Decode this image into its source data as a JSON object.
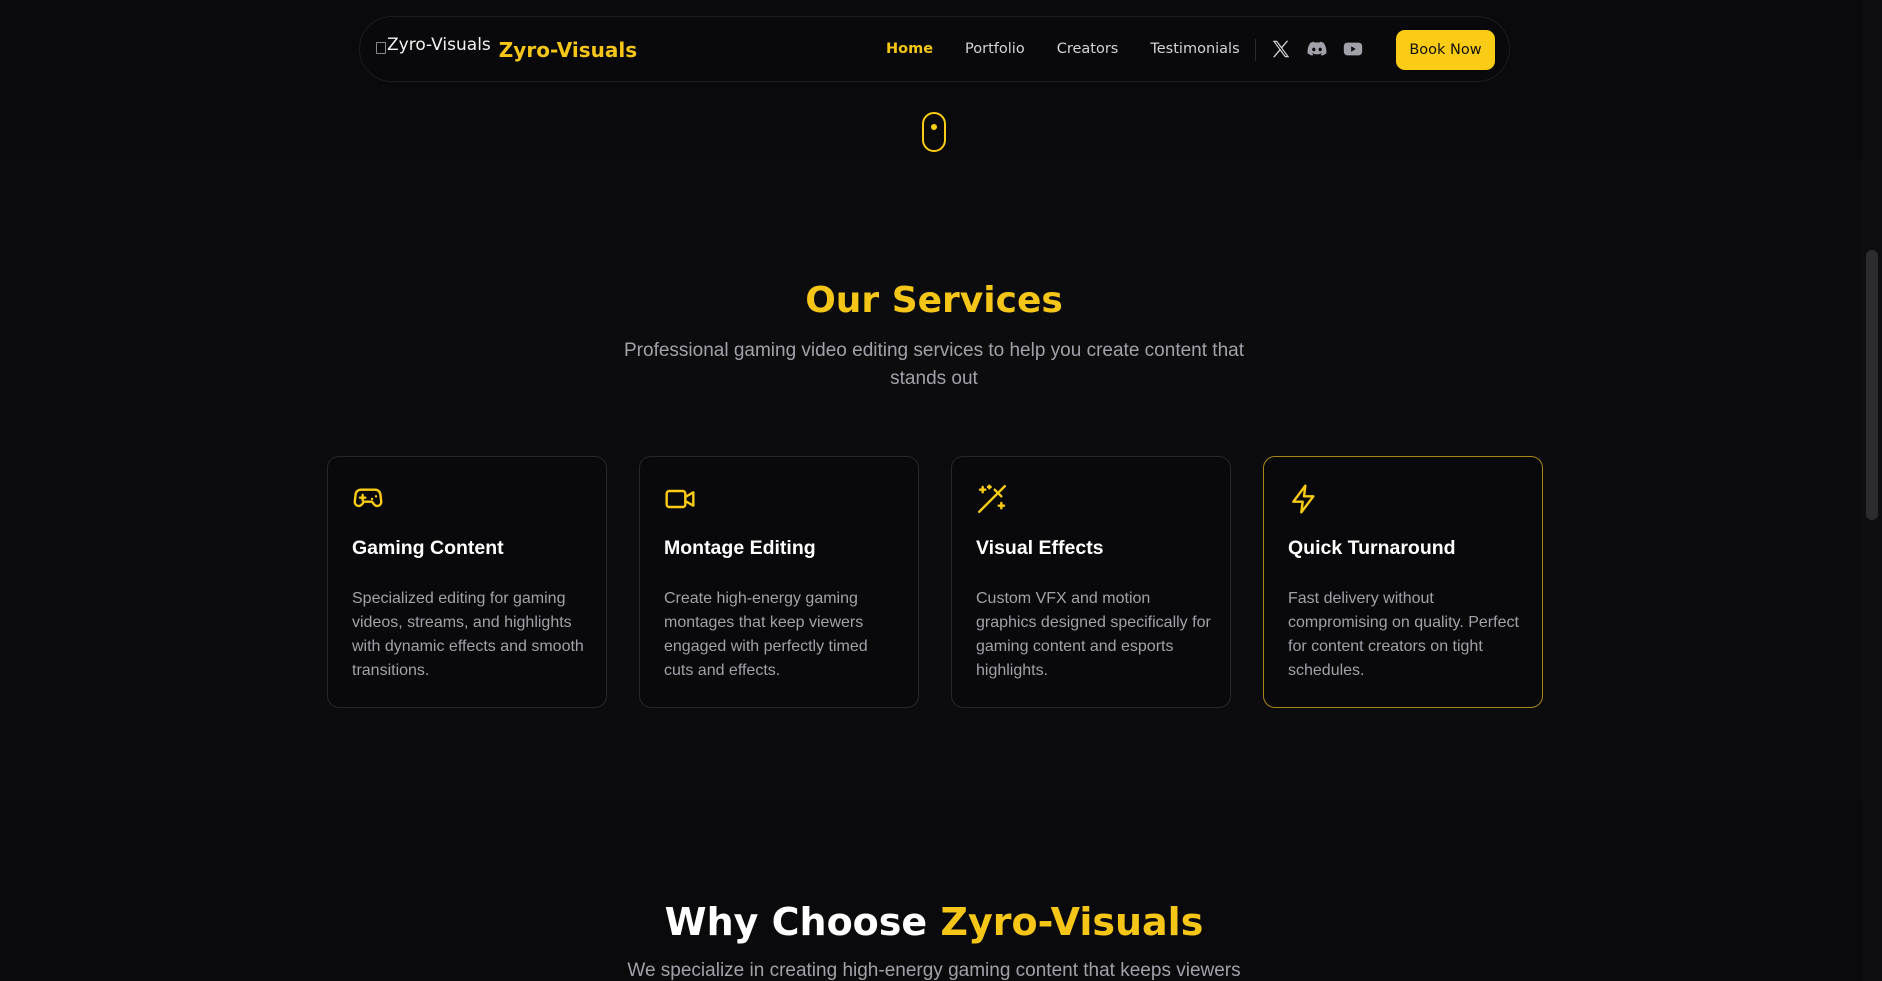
{
  "nav": {
    "logo_alt": "Zyro-Visuals",
    "brand_name": "Zyro-Visuals",
    "links": [
      {
        "label": "Home",
        "active": true
      },
      {
        "label": "Portfolio",
        "active": false
      },
      {
        "label": "Creators",
        "active": false
      },
      {
        "label": "Testimonials",
        "active": false
      }
    ],
    "socials": [
      {
        "icon": "x-twitter-icon"
      },
      {
        "icon": "discord-icon"
      },
      {
        "icon": "youtube-icon"
      }
    ],
    "cta_label": "Book Now"
  },
  "scroll_indicator": {
    "icon": "mouse-scroll-icon"
  },
  "services": {
    "title": "Our Services",
    "subtitle": "Professional gaming video editing services to help you create content that stands out",
    "cards": [
      {
        "icon": "gamepad-icon",
        "title": "Gaming Content",
        "description": "Specialized editing for gaming videos, streams, and highlights with dynamic effects and smooth transitions."
      },
      {
        "icon": "video-camera-icon",
        "title": "Montage Editing",
        "description": "Create high-energy gaming montages that keep viewers engaged with perfectly timed cuts and effects."
      },
      {
        "icon": "magic-wand-icon",
        "title": "Visual Effects",
        "description": "Custom VFX and motion graphics designed specifically for gaming content and esports highlights."
      },
      {
        "icon": "lightning-icon",
        "title": "Quick Turnaround",
        "description": "Fast delivery without compromising on quality. Perfect for content creators on tight schedules."
      }
    ]
  },
  "why": {
    "title_prefix": "Why Choose",
    "title_accent": "Zyro-Visuals",
    "subtitle": "We specialize in creating high-energy gaming content that keeps viewers"
  },
  "colors": {
    "accent": "#facc15",
    "background": "#0a0a0c",
    "card_border": "#27272a",
    "muted_text": "#a1a1aa"
  }
}
